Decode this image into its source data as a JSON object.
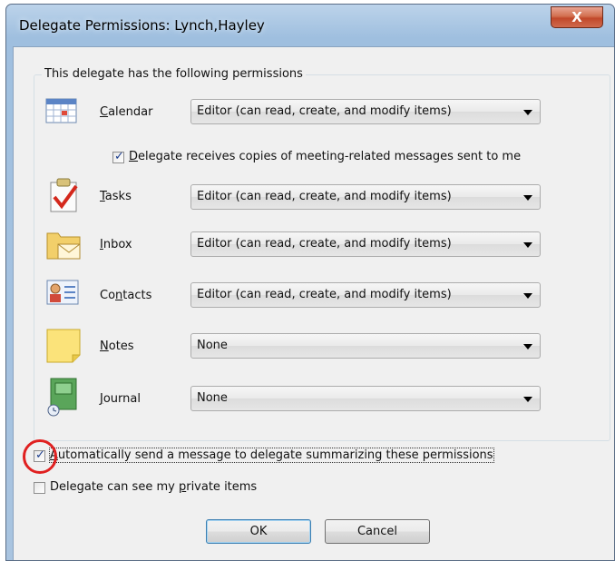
{
  "window": {
    "title": "Delegate Permissions: Lynch,Hayley",
    "close_glyph": "X"
  },
  "group": {
    "legend": "This delegate has the following permissions"
  },
  "permissions": [
    {
      "key": "calendar",
      "label_first": "C",
      "label_rest": "alendar",
      "value": "Editor (can read, create, and modify items)",
      "icon": "calendar-icon"
    },
    {
      "key": "tasks",
      "label_first": "T",
      "label_rest": "asks",
      "value": "Editor (can read, create, and modify items)",
      "icon": "tasks-icon"
    },
    {
      "key": "inbox",
      "label_first": "I",
      "label_rest": "nbox",
      "value": "Editor (can read, create, and modify items)",
      "icon": "inbox-icon"
    },
    {
      "key": "contacts",
      "label_first": "Co",
      "label_under": "n",
      "label_rest": "tacts",
      "value": "Editor (can read, create, and modify items)",
      "icon": "contacts-icon"
    },
    {
      "key": "notes",
      "label_first": "N",
      "label_rest": "otes",
      "value": "None",
      "icon": "notes-icon"
    },
    {
      "key": "journal",
      "label_first": "J",
      "label_rest": "ournal",
      "value": "None",
      "icon": "journal-icon"
    }
  ],
  "meeting_copies": {
    "checked": true,
    "label_first": "D",
    "label_rest": "elegate receives copies of meeting-related messages sent to me"
  },
  "auto_send": {
    "checked": true,
    "label_first": "A",
    "label_rest": "utomatically send a message to delegate summarizing these permissions"
  },
  "private_items": {
    "checked": false,
    "label_pre": "Delegate can see my ",
    "label_under": "p",
    "label_rest": "rivate items"
  },
  "buttons": {
    "ok": "OK",
    "cancel": "Cancel"
  },
  "colors": {
    "accent_red_circle": "#e02020",
    "close_button": "#c1482a"
  }
}
